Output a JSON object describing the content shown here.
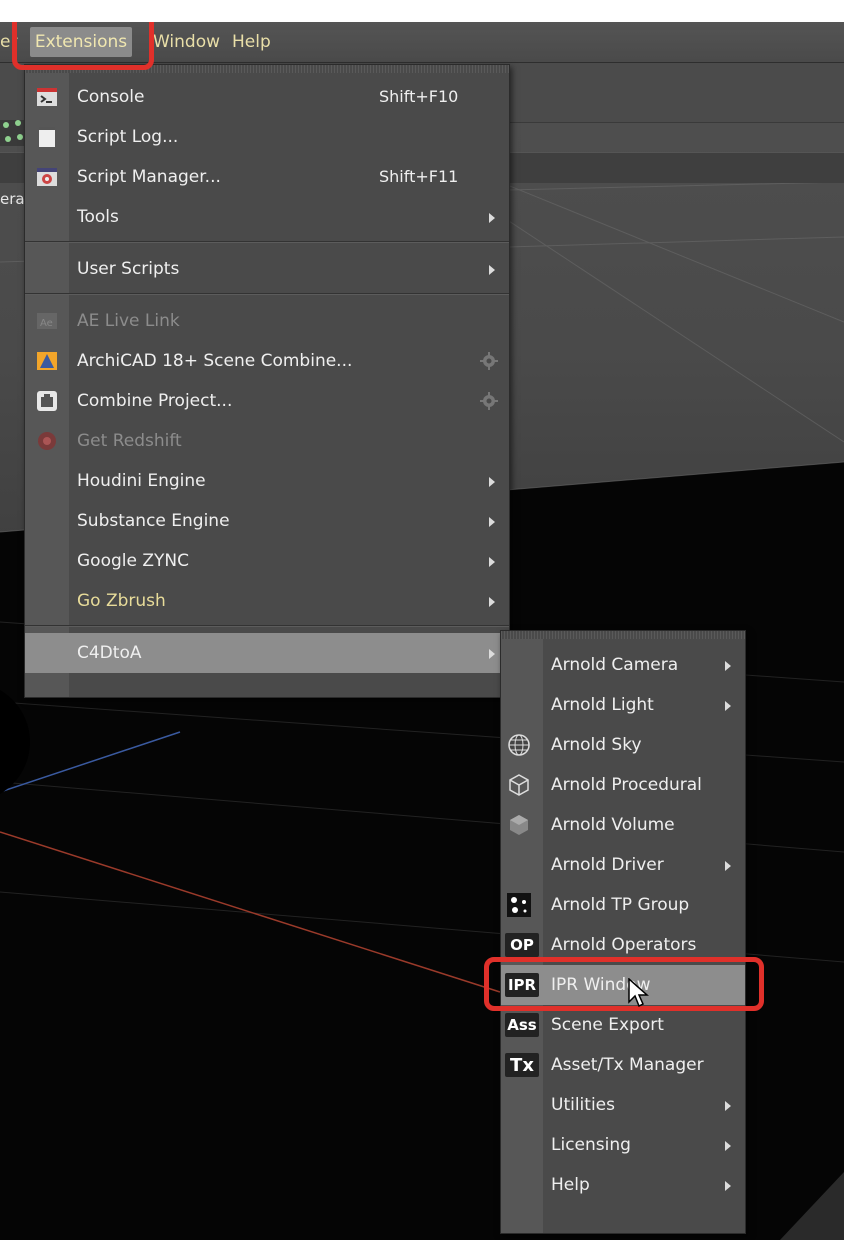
{
  "menubar": {
    "items": [
      {
        "id": "render",
        "label": "er"
      },
      {
        "id": "extensions",
        "label": "Extensions"
      },
      {
        "id": "window",
        "label": "Window"
      },
      {
        "id": "help",
        "label": "Help"
      }
    ]
  },
  "viewport": {
    "camera_label": "era"
  },
  "extensions_menu": {
    "items": [
      {
        "label": "Console",
        "shortcut": "Shift+F10",
        "icon": "console-icon"
      },
      {
        "label": "Script Log...",
        "shortcut": "",
        "icon": "script-log-icon"
      },
      {
        "label": "Script Manager...",
        "shortcut": "Shift+F11",
        "icon": "script-manager-icon"
      },
      {
        "label": "Tools",
        "submenu": true
      },
      {
        "label": "User Scripts",
        "submenu": true
      },
      {
        "label": "AE Live Link",
        "disabled": true,
        "icon": "ae-live-link-icon"
      },
      {
        "label": "ArchiCAD 18+ Scene Combine...",
        "icon": "archicad-icon",
        "settings": true
      },
      {
        "label": "Combine Project...",
        "icon": "combine-project-icon",
        "settings": true
      },
      {
        "label": "Get Redshift",
        "disabled": true,
        "icon": "redshift-icon"
      },
      {
        "label": "Houdini Engine",
        "submenu": true
      },
      {
        "label": "Substance Engine",
        "submenu": true
      },
      {
        "label": "Google ZYNC",
        "submenu": true
      },
      {
        "label": "Go Zbrush",
        "submenu": true,
        "highlight_color": "#e8dc9a"
      },
      {
        "label": "C4DtoA",
        "submenu": true,
        "selected": true
      }
    ]
  },
  "c4dtoa_menu": {
    "items": [
      {
        "label": "Arnold Camera",
        "submenu": true
      },
      {
        "label": "Arnold Light",
        "submenu": true
      },
      {
        "label": "Arnold Sky",
        "icon": "globe-icon"
      },
      {
        "label": "Arnold Procedural",
        "icon": "cube-wireframe-icon"
      },
      {
        "label": "Arnold Volume",
        "icon": "volume-cube-icon"
      },
      {
        "label": "Arnold Driver",
        "submenu": true
      },
      {
        "label": "Arnold TP Group",
        "icon": "tp-group-icon"
      },
      {
        "label": "Arnold Operators",
        "icon": "op-icon",
        "icon_text": "OP"
      },
      {
        "label": "IPR Window",
        "icon": "ipr-icon",
        "icon_text": "IPR",
        "hovered": true
      },
      {
        "label": "Scene Export",
        "icon": "ass-icon",
        "icon_text": "Ass"
      },
      {
        "label": "Asset/Tx Manager",
        "icon": "tx-icon",
        "icon_text": "Tx"
      },
      {
        "label": "Utilities",
        "submenu": true
      },
      {
        "label": "Licensing",
        "submenu": true
      },
      {
        "label": "Help",
        "submenu": true
      }
    ]
  },
  "colors": {
    "highlight": "#e0302a",
    "menu_bg": "#4a4a4a",
    "menubar_text": "#e9dfa8",
    "selected_bg": "#8d8d8d"
  }
}
